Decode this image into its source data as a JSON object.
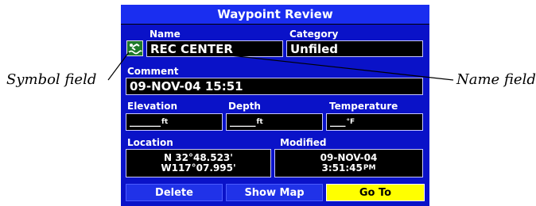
{
  "title": "Waypoint Review",
  "symbol_icon": "swimmer-icon",
  "name": {
    "label": "Name",
    "value": "REC CENTER"
  },
  "category": {
    "label": "Category",
    "value": "Unfiled"
  },
  "comment": {
    "label": "Comment",
    "value": "09-NOV-04 15:51"
  },
  "elevation": {
    "label": "Elevation",
    "value": "______",
    "unit": "ft"
  },
  "depth": {
    "label": "Depth",
    "value": "_____",
    "unit": "ft"
  },
  "temperature": {
    "label": "Temperature",
    "value": "___",
    "unit": "°F"
  },
  "location": {
    "label": "Location",
    "lat": "N 32°48.523'",
    "lon": "W117°07.995'"
  },
  "modified": {
    "label": "Modified",
    "date": "09-NOV-04",
    "time": "3:51:45",
    "time_suffix": "PM"
  },
  "buttons": {
    "delete": "Delete",
    "show_map": "Show Map",
    "go_to": "Go To"
  },
  "callouts": {
    "symbol_field": "Symbol field",
    "name_field": "Name field"
  }
}
